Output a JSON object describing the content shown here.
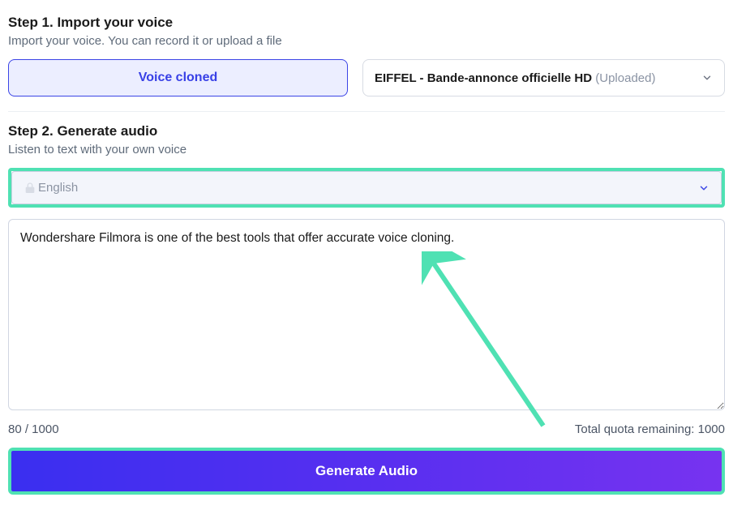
{
  "step1": {
    "title": "Step 1. Import your voice",
    "sub": "Import your voice. You can record it or upload a file",
    "voice_cloned_label": "Voice cloned",
    "uploaded_main": "EIFFEL - Bande-annonce officielle HD ",
    "uploaded_suffix": "(Uploaded)"
  },
  "step2": {
    "title": "Step 2. Generate audio",
    "sub": "Listen to text with your own voice",
    "language": "English",
    "textarea_value": "Wondershare Filmora is one of the best tools that offer accurate voice cloning.",
    "char_count": "80 / 1000",
    "quota": "Total quota remaining: 1000",
    "generate_label": "Generate Audio"
  }
}
